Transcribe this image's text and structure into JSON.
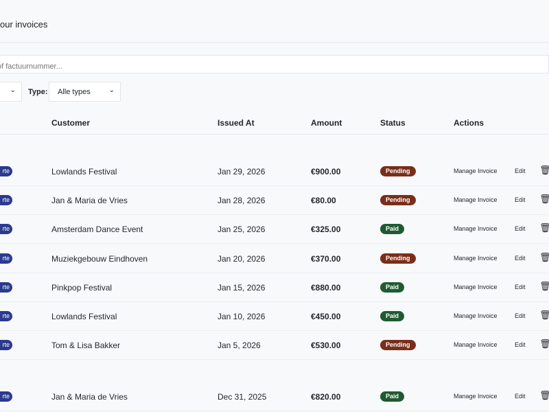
{
  "header": {
    "subtitle": "our invoices"
  },
  "search": {
    "placeholder": "of factuurnummer..."
  },
  "filters": {
    "type_label": "Type:",
    "type_value": "Alle types"
  },
  "table": {
    "headers": [
      "Customer",
      "Issued At",
      "Amount",
      "Status",
      "Actions"
    ],
    "type_badge": "rte",
    "actions": {
      "manage": "Manage Invoice",
      "edit": "Edit"
    },
    "rows": [
      {
        "customer": "Lowlands Festival",
        "issued": "Jan 29, 2026",
        "amount": "€900.00",
        "status": "Pending"
      },
      {
        "customer": "Jan & Maria de Vries",
        "issued": "Jan 28, 2026",
        "amount": "€80.00",
        "status": "Pending"
      },
      {
        "customer": "Amsterdam Dance Event",
        "issued": "Jan 25, 2026",
        "amount": "€325.00",
        "status": "Paid"
      },
      {
        "customer": "Muziekgebouw Eindhoven",
        "issued": "Jan 20, 2026",
        "amount": "€370.00",
        "status": "Pending"
      },
      {
        "customer": "Pinkpop Festival",
        "issued": "Jan 15, 2026",
        "amount": "€880.00",
        "status": "Paid"
      },
      {
        "customer": "Lowlands Festival",
        "issued": "Jan 10, 2026",
        "amount": "€450.00",
        "status": "Paid"
      },
      {
        "customer": "Tom & Lisa Bakker",
        "issued": "Jan 5, 2026",
        "amount": "€530.00",
        "status": "Pending"
      },
      {
        "customer": "Jan & Maria de Vries",
        "issued": "Dec 31, 2025",
        "amount": "€820.00",
        "status": "Paid"
      }
    ]
  },
  "colors": {
    "pending": "#7a2e1a",
    "paid": "#1f5a32",
    "type_badge": "#2b3a8f"
  }
}
